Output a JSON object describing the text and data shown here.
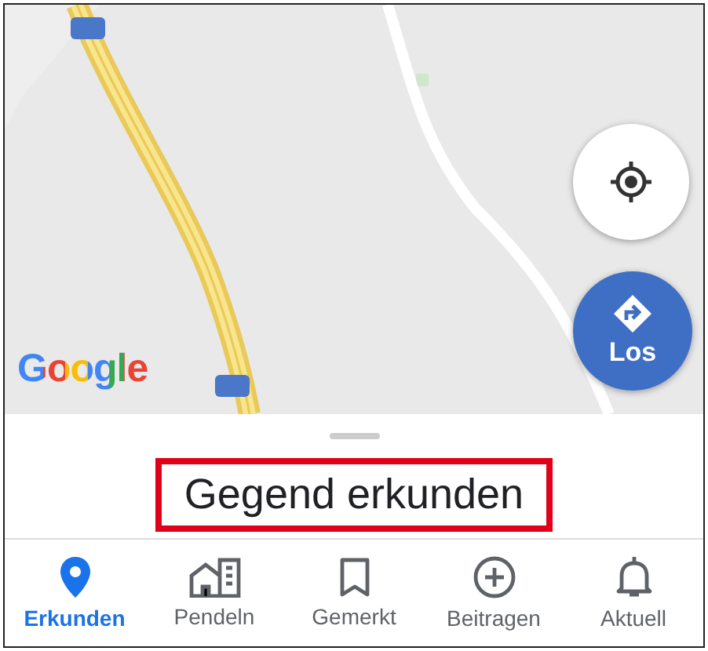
{
  "logo": "Google",
  "go_button": {
    "label": "Los"
  },
  "sheet": {
    "title": "Gegend erkunden",
    "highlighted": true
  },
  "nav": [
    {
      "label": "Erkunden",
      "kind": "explore",
      "selected": true
    },
    {
      "label": "Pendeln",
      "kind": "commute",
      "selected": false
    },
    {
      "label": "Gemerkt",
      "kind": "saved",
      "selected": false
    },
    {
      "label": "Beitragen",
      "kind": "contribute",
      "selected": false
    },
    {
      "label": "Aktuell",
      "kind": "updates",
      "selected": false
    }
  ]
}
